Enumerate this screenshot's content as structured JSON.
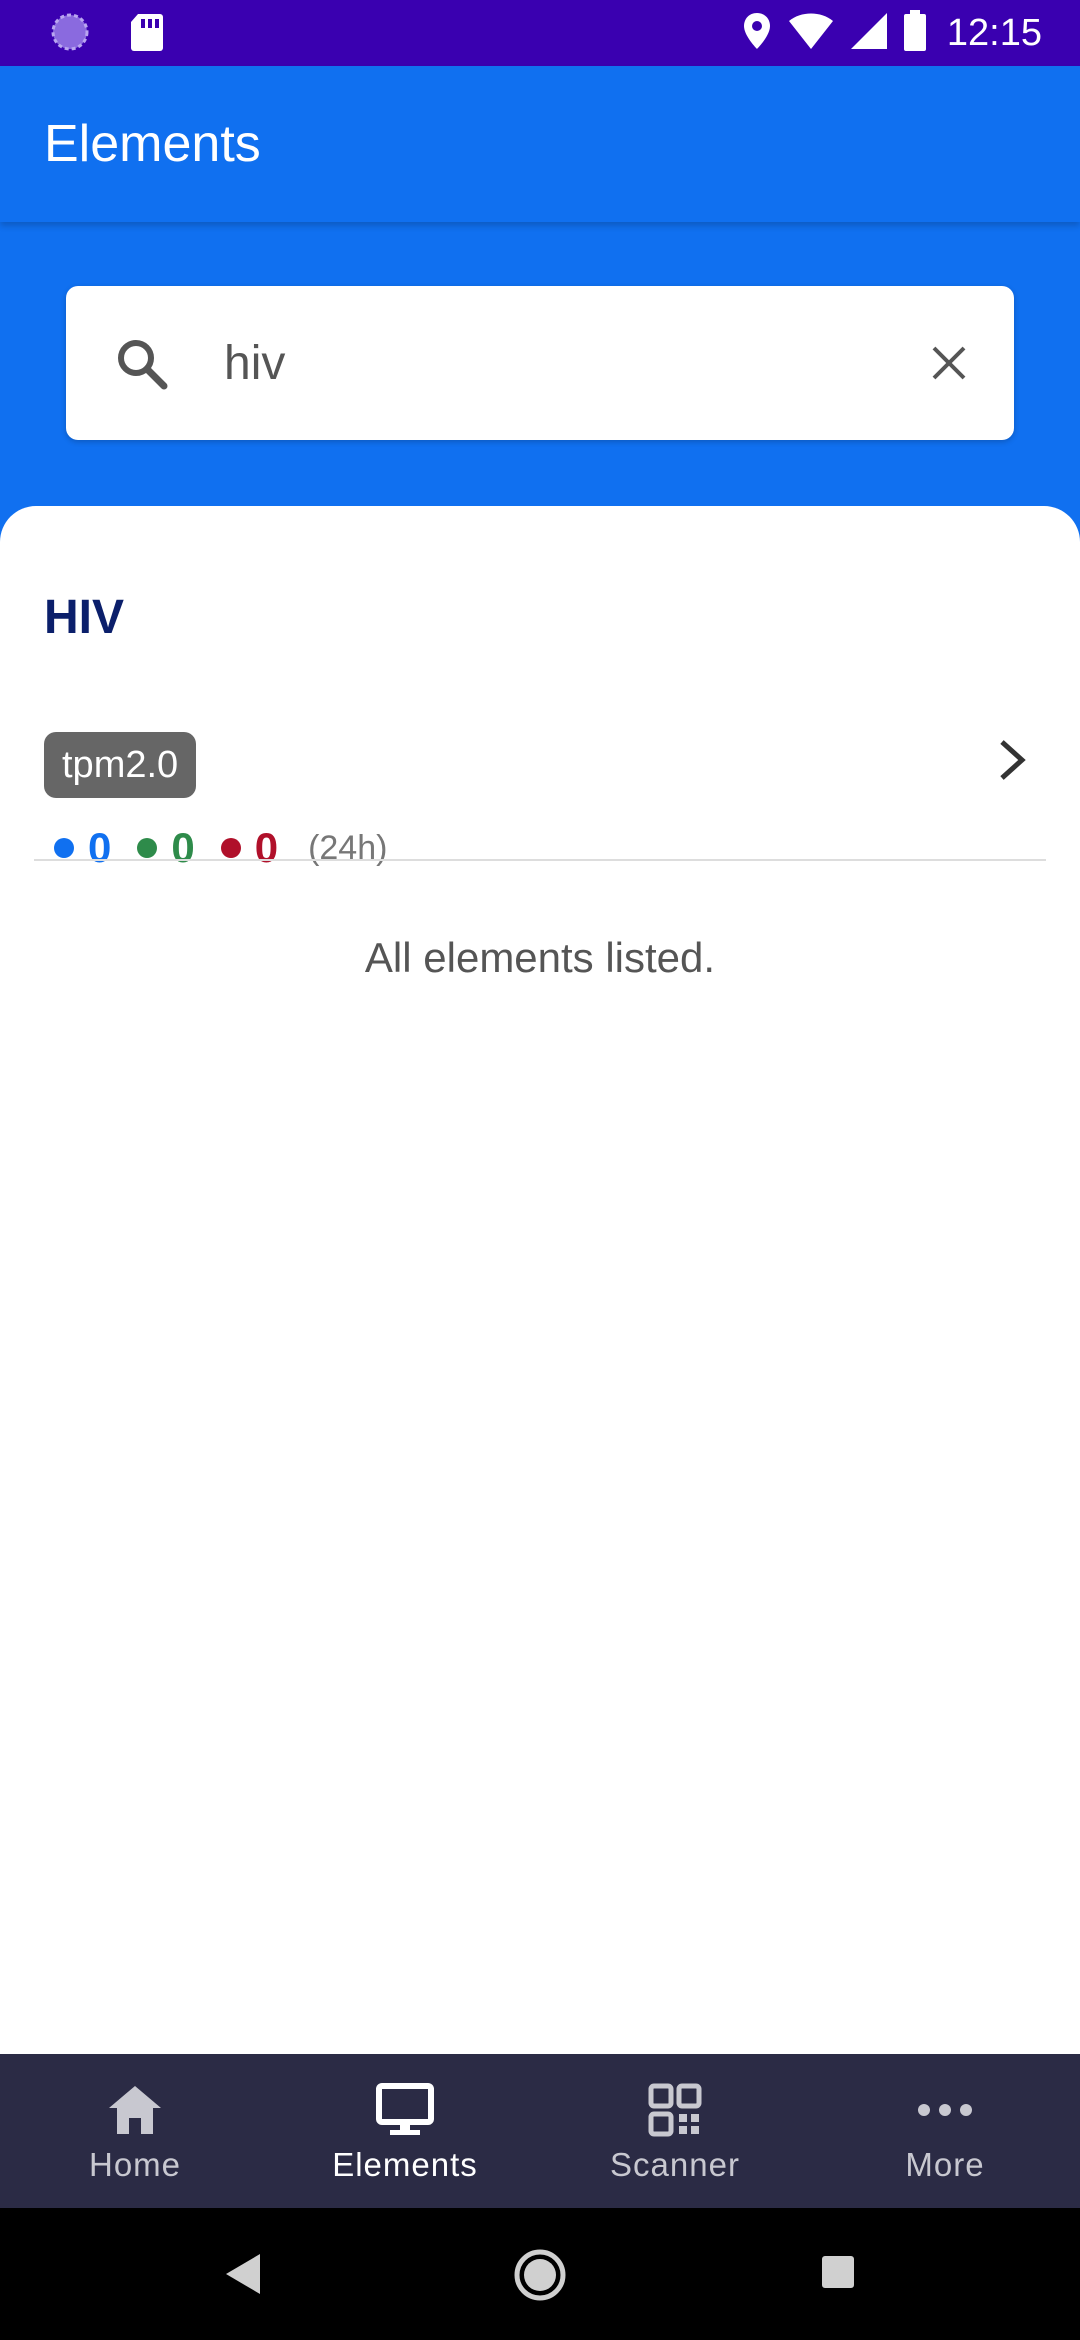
{
  "status_bar": {
    "time": "12:15",
    "icons": [
      "sync-icon",
      "sd-card-icon",
      "location-icon",
      "wifi-icon",
      "cell-signal-icon",
      "battery-icon"
    ]
  },
  "app_bar": {
    "title": "Elements"
  },
  "search": {
    "value": "hiv",
    "icon": "search-icon",
    "clear_icon": "close-icon"
  },
  "elements": [
    {
      "name": "HIV",
      "tag": "tpm2.0",
      "stats": {
        "blue": "0",
        "green": "0",
        "red": "0",
        "period": "(24h)"
      }
    }
  ],
  "footer_text": "All elements listed.",
  "bottom_nav": {
    "items": [
      {
        "label": "Home",
        "icon": "home-icon"
      },
      {
        "label": "Elements",
        "icon": "monitor-icon",
        "active": true
      },
      {
        "label": "Scanner",
        "icon": "qr-code-icon"
      },
      {
        "label": "More",
        "icon": "more-horizontal-icon"
      }
    ]
  },
  "colors": {
    "status_bar": "#3a00b0",
    "primary": "#1070f0",
    "element_name": "#0b1f6b",
    "stat_blue": "#1070f0",
    "stat_green": "#2e8b4a",
    "stat_red": "#b0102a",
    "bottom_nav": "#2b2b45"
  }
}
